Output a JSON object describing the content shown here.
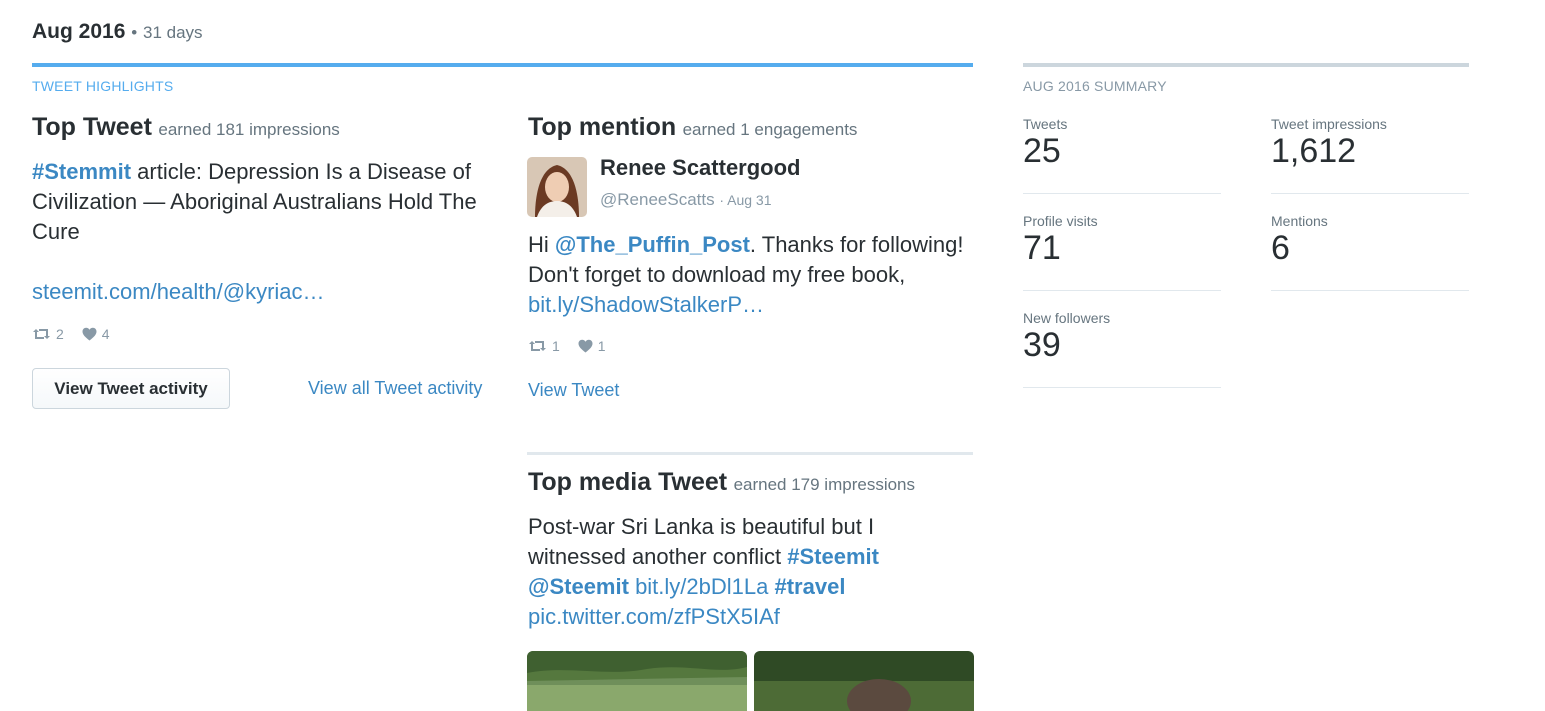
{
  "period": {
    "label": "Aug 2016",
    "separator": "•",
    "days": "31 days"
  },
  "highlights": {
    "section_label": "TWEET HIGHLIGHTS",
    "top_tweet": {
      "heading": "Top Tweet",
      "earned": "earned 181 impressions",
      "hashtag": "#Stemmit",
      "text": " article: Depression Is a Disease of Civilization — Aboriginal Australians Hold The Cure",
      "link": "steemit.com/health/@kyriac…",
      "retweets": "2",
      "likes": "4",
      "button_label": "View Tweet activity",
      "view_all_label": "View all Tweet activity"
    },
    "top_mention": {
      "heading": "Top mention",
      "earned": "earned 1 engagements",
      "name": "Renee Scattergood",
      "handle": "@ReneeScatts",
      "date": "· Aug 31",
      "text_hi": "Hi ",
      "mention": "@The_Puffin_Post",
      "text_body": ". Thanks for following! Don't forget to download my free book, ",
      "link": "bit.ly/ShadowStalkerP…",
      "retweets": "1",
      "likes": "1",
      "view_label": "View Tweet"
    },
    "top_media": {
      "heading": "Top media Tweet",
      "earned": "earned 179 impressions",
      "text": "Post-war Sri Lanka is beautiful but I witnessed another conflict ",
      "hashtag1": "#Steemit",
      "mention": "@Steemit",
      "link": "bit.ly/2bDl1La",
      "hashtag2": "#travel",
      "pic_link": "pic.twitter.com/zfPStX5IAf"
    }
  },
  "summary": {
    "section_label": "AUG 2016 SUMMARY",
    "stats": [
      {
        "label": "Tweets",
        "value": "25"
      },
      {
        "label": "Tweet impressions",
        "value": "1,612"
      },
      {
        "label": "Profile visits",
        "value": "71"
      },
      {
        "label": "Mentions",
        "value": "6"
      },
      {
        "label": "New followers",
        "value": "39"
      }
    ]
  },
  "icons": {
    "retweet": "retweet-icon",
    "like": "heart-icon"
  },
  "colors": {
    "accent": "#55acee",
    "link": "#3b88c3",
    "text": "#292f33",
    "muted": "#8899a6"
  }
}
